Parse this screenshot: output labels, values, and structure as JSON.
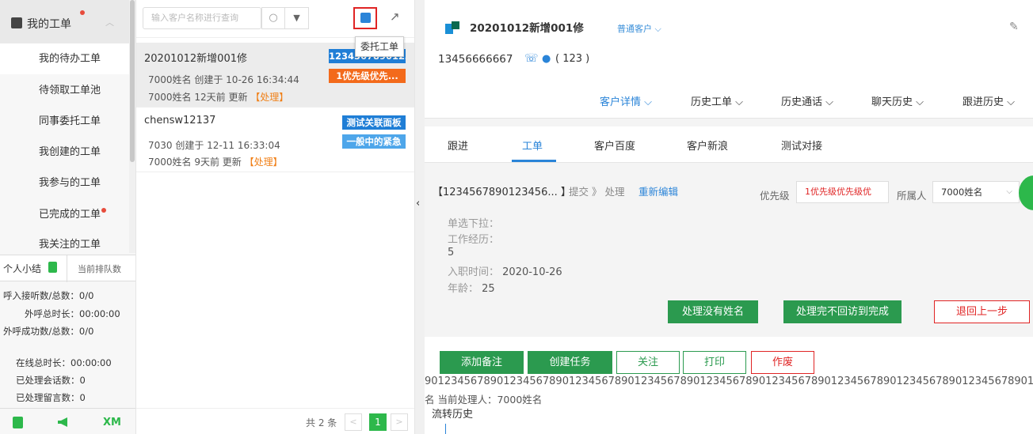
{
  "sidebar": {
    "header_label": "我的工单",
    "items": [
      {
        "label": "我的待办工单"
      },
      {
        "label": "待领取工单池"
      },
      {
        "label": "同事委托工单"
      },
      {
        "label": "我创建的工单"
      },
      {
        "label": "我参与的工单"
      },
      {
        "label": "已完成的工单"
      },
      {
        "label": "我关注的工单"
      }
    ],
    "summary_tab": "个人小结",
    "queue_tab": "当前排队数",
    "stats": [
      "呼入接听数/总数：0/0",
      "外呼总时长：00:00:00",
      "外呼成功数/总数：0/0",
      "在线总时长：00:00:00",
      "已处理会话数：0",
      "已处理留言数：0"
    ],
    "footer_xm": "XM"
  },
  "list": {
    "search_placeholder": "输入客户名称进行查询",
    "tooltip": "委托工单",
    "action_label": "【处理】",
    "cards": [
      {
        "title": "20201012新增001修",
        "meta1": "7000姓名 创建于 10-26 16:34:44",
        "meta2": "7000姓名 12天前 更新",
        "tag1": "1234567890123456",
        "tag2": "1优先级优先..."
      },
      {
        "title": "chensw12137",
        "meta1": "7030 创建于 12-11 16:33:04",
        "meta2": "7000姓名 9天前 更新",
        "tag1": "测试关联面板",
        "tag2": "一般中的紧急"
      }
    ],
    "pager": {
      "total": "共 2 条",
      "current": "1"
    }
  },
  "customer": {
    "name": "20201012新增001修",
    "type": "普通客户",
    "phone": "13456666667",
    "chat_count": "( 123 )",
    "tabs": [
      "客户详情",
      "历史工单",
      "历史通话",
      "聊天历史",
      "跟进历史"
    ]
  },
  "work_tabs": [
    "跟进",
    "工单",
    "客户百度",
    "客户新浪",
    "测试对接"
  ],
  "ticket": {
    "id": "【1234567890123456...  】",
    "flow": "提交 》 处理",
    "reedit": "重新编辑",
    "priority_label": "优先级",
    "priority_value": "1优先级优先级优",
    "owner_label": "所属人",
    "owner_value": "7000姓名",
    "fields": [
      {
        "label": "单选下拉：",
        "value": ""
      },
      {
        "label": "工作经历：",
        "value": ""
      },
      {
        "label": "",
        "value": "5"
      },
      {
        "label": "入职时间：",
        "value": "2020-10-26"
      },
      {
        "label": "年龄：",
        "value": "25"
      }
    ],
    "actions": [
      "处理没有姓名",
      "处理完不回访到完成",
      "退回上一步"
    ]
  },
  "bottom": {
    "buttons": [
      "添加备注",
      "创建任务",
      "关注",
      "打印",
      "作废"
    ],
    "digits": "9012345678901234567890123456789012345678901234567890123456789012345678901234567890123456789012345678901",
    "handler": "名  当前处理人：7000姓名",
    "history": "流转历史"
  },
  "colors": {
    "green": "#2db84b",
    "blue": "#2a84d8",
    "orange": "#f36a1b",
    "red": "#e02424"
  }
}
